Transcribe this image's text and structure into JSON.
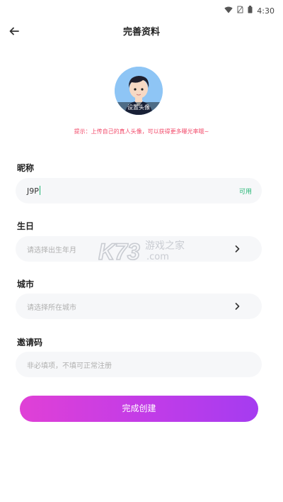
{
  "status_bar": {
    "time": "4:30",
    "icons": [
      "wifi-icon",
      "no-sim-icon",
      "battery-icon"
    ]
  },
  "header": {
    "title": "完善资料",
    "back_icon": "back-arrow-icon"
  },
  "avatar": {
    "caption": "设置头像"
  },
  "tip": "提示：上传自己的真人头像，可以获得更多曝光率哦~",
  "form": {
    "nickname": {
      "label": "昵称",
      "value": "J9P",
      "status": "可用"
    },
    "birthday": {
      "label": "生日",
      "placeholder": "请选择出生年月"
    },
    "city": {
      "label": "城市",
      "placeholder": "请选择所在城市"
    },
    "invite_code": {
      "label": "邀请码",
      "placeholder": "非必填项，不填可正常注册"
    }
  },
  "watermark": {
    "logo": "K73",
    "text": "游戏之家",
    "domain": ".com"
  },
  "submit": {
    "label": "完成创建"
  },
  "colors": {
    "accent_start": "#e040d6",
    "accent_end": "#a53cf0",
    "tip": "#f24a6a",
    "available": "#22b573"
  }
}
